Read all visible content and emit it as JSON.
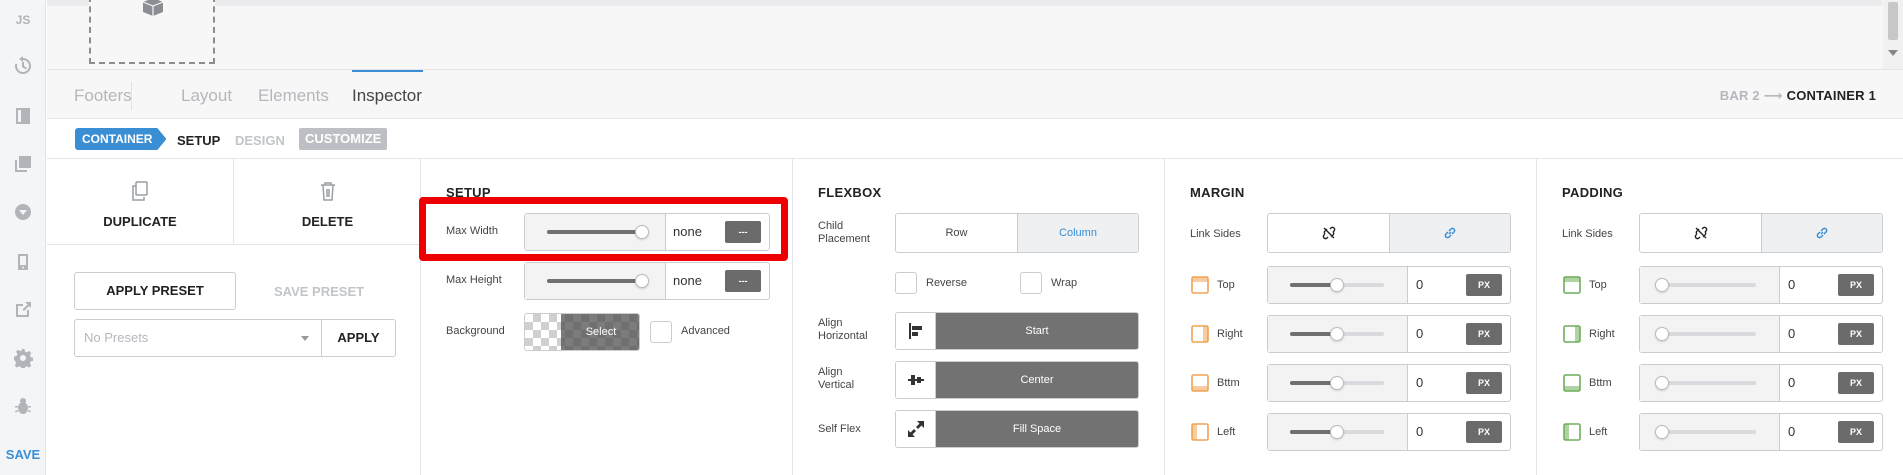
{
  "sidebar": {
    "js_label": "JS",
    "save_label": "SAVE",
    "icons": [
      "history-icon",
      "layout-icon",
      "layers-icon",
      "dropdown-circle-icon",
      "device-icon",
      "external-link-icon",
      "gear-icon",
      "bug-icon"
    ]
  },
  "tabs": {
    "items": [
      {
        "label": "Footers"
      },
      {
        "label": "Layout"
      },
      {
        "label": "Elements"
      },
      {
        "label": "Inspector"
      }
    ],
    "active": "Inspector"
  },
  "breadcrumb": {
    "parent": "BAR 2",
    "arrow": "⟶",
    "current": "CONTAINER 1"
  },
  "subtabs": {
    "container": "CONTAINER",
    "setup": "SETUP",
    "design": "DESIGN",
    "customize": "CUSTOMIZE"
  },
  "actions": {
    "duplicate": "DUPLICATE",
    "delete": "DELETE",
    "apply_preset": "APPLY PRESET",
    "save_preset": "SAVE PRESET",
    "preset_placeholder": "No Presets",
    "apply": "APPLY"
  },
  "setup": {
    "title": "SETUP",
    "max_width": {
      "label": "Max Width",
      "value": "none",
      "unit": "---",
      "level": 0.95
    },
    "max_height": {
      "label": "Max Height",
      "value": "none",
      "unit": "---",
      "level": 0.95
    },
    "background": {
      "label": "Background",
      "select": "Select",
      "advanced": "Advanced"
    }
  },
  "flexbox": {
    "title": "FLEXBOX",
    "child_placement": {
      "label1": "Child",
      "label2": "Placement",
      "row": "Row",
      "column": "Column"
    },
    "reverse": "Reverse",
    "wrap": "Wrap",
    "align_h": {
      "label1": "Align",
      "label2": "Horizontal",
      "value": "Start"
    },
    "align_v": {
      "label1": "Align",
      "label2": "Vertical",
      "value": "Center"
    },
    "self_flex": {
      "label": "Self Flex",
      "value": "Fill Space"
    }
  },
  "margin": {
    "title": "MARGIN",
    "link_sides": "Link Sides",
    "rows": [
      {
        "label": "Top",
        "value": "0",
        "unit": "PX",
        "level": 0.5
      },
      {
        "label": "Right",
        "value": "0",
        "unit": "PX",
        "level": 0.5
      },
      {
        "label": "Bttm",
        "value": "0",
        "unit": "PX",
        "level": 0.5
      },
      {
        "label": "Left",
        "value": "0",
        "unit": "PX",
        "level": 0.5
      }
    ],
    "accent": "#f0a254"
  },
  "padding": {
    "title": "PADDING",
    "link_sides": "Link Sides",
    "rows": [
      {
        "label": "Top",
        "value": "0",
        "unit": "PX",
        "level": 0.0
      },
      {
        "label": "Right",
        "value": "0",
        "unit": "PX",
        "level": 0.0
      },
      {
        "label": "Bttm",
        "value": "0",
        "unit": "PX",
        "level": 0.0
      },
      {
        "label": "Left",
        "value": "0",
        "unit": "PX",
        "level": 0.0
      }
    ],
    "accent": "#6fae5a"
  },
  "colors": {
    "accent_blue": "#3a8fd4",
    "highlight_red": "#ee0000",
    "dark_button": "#6b6b6b"
  }
}
